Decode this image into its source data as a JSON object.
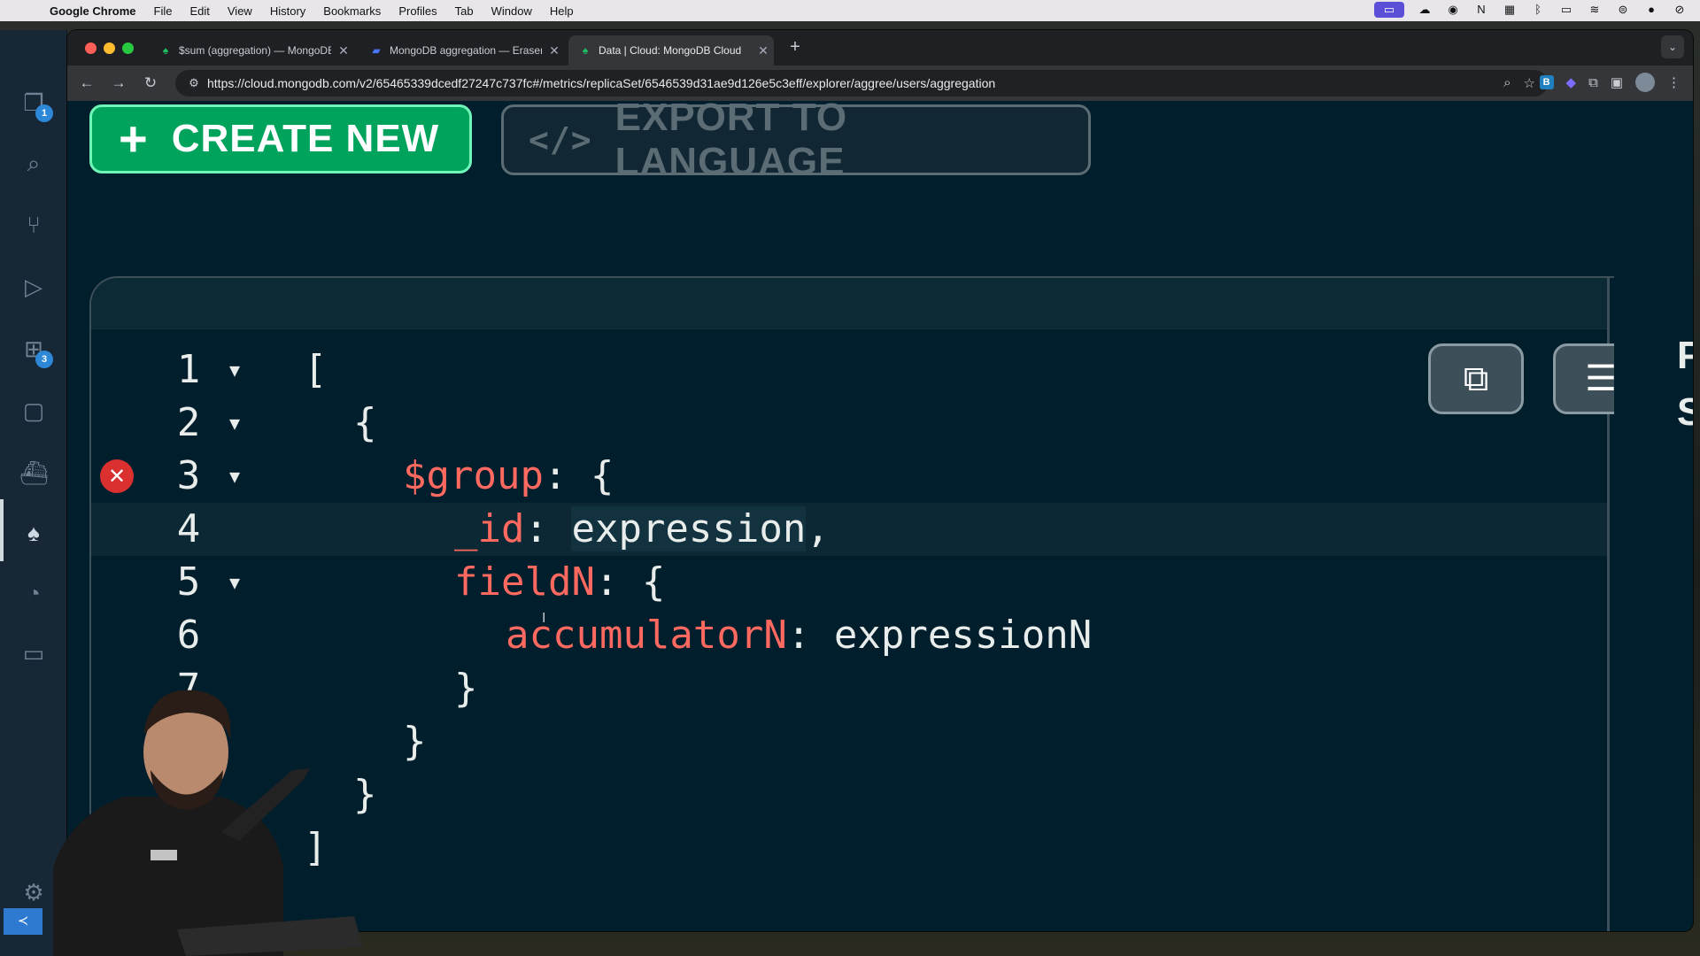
{
  "menubar": {
    "app_name": "Google Chrome",
    "items": [
      "File",
      "Edit",
      "View",
      "History",
      "Bookmarks",
      "Profiles",
      "Tab",
      "Window",
      "Help"
    ]
  },
  "activity_bar": {
    "explorer_badge": "1",
    "extensions_badge": "3"
  },
  "tabs": [
    {
      "title": "$sum (aggregation) — MongoDB",
      "favicon": "mongodb-leaf-icon"
    },
    {
      "title": "MongoDB aggregation — Eraser",
      "favicon": "eraser-icon"
    },
    {
      "title": "Data | Cloud: MongoDB Cloud",
      "favicon": "mongodb-leaf-icon"
    }
  ],
  "address_bar": {
    "url": "https://cloud.mongodb.com/v2/65465339dcedf27247c737fc#/metrics/replicaSet/6546539d31ae9d126e5c3eff/explorer/aggree/users/aggregation"
  },
  "toolbar": {
    "create_new_label": "CREATE NEW",
    "export_label": "EXPORT TO LANGUAGE"
  },
  "editor": {
    "lines": [
      {
        "n": "1",
        "fold": true,
        "error": false
      },
      {
        "n": "2",
        "fold": true,
        "error": false
      },
      {
        "n": "3",
        "fold": true,
        "error": true
      },
      {
        "n": "4",
        "fold": false,
        "error": false
      },
      {
        "n": "5",
        "fold": true,
        "error": false
      },
      {
        "n": "6",
        "fold": false,
        "error": false
      },
      {
        "n": "7",
        "fold": false,
        "error": false
      }
    ],
    "code": {
      "l1": "[",
      "l2": "{",
      "l3_key": "$group",
      "l3_rest": ": {",
      "l4_key": "_id",
      "l4_colon": ": ",
      "l4_val": "expression",
      "l4_comma": ",",
      "l5_key": "fieldN",
      "l5_rest": ": {",
      "l6_key": "accumulatorN",
      "l6_colon": ": ",
      "l6_val": "expressionN",
      "l7": "}",
      "l8": "}",
      "l9": "}",
      "l10": "]"
    }
  },
  "side_letters": [
    "P",
    "S"
  ],
  "colors": {
    "page_bg": "#001e2b",
    "create_green": "#00a35c",
    "create_border": "#71f6ba",
    "keyword_red": "#ff6960",
    "error_red": "#db3030"
  }
}
